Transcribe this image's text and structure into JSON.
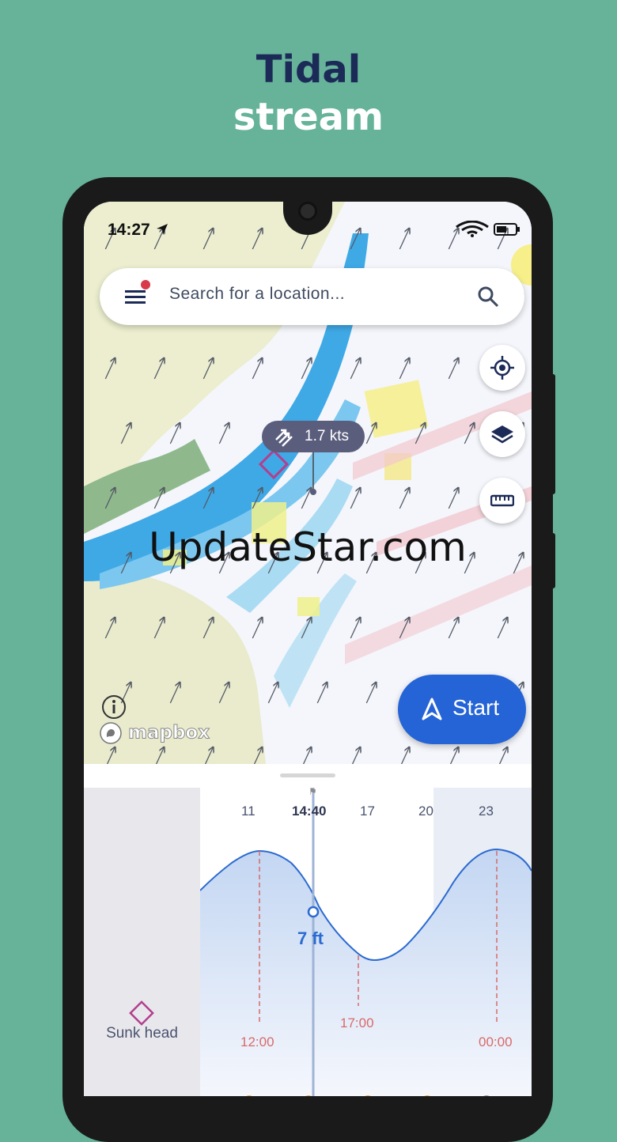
{
  "hero": {
    "line1": "Tidal",
    "line2": "stream"
  },
  "status": {
    "time": "14:27"
  },
  "search": {
    "placeholder": "Search for a location..."
  },
  "callout": {
    "speed": "1.7 kts"
  },
  "start_button": {
    "label": "Start"
  },
  "watermark": "UpdateStar.com",
  "attribution": "mapbox",
  "location": {
    "name": "Sunk head"
  },
  "tide": {
    "current_time": "14:40",
    "hour_ticks": [
      "11",
      "17",
      "20",
      "23"
    ],
    "current_height": "7 ft",
    "events": [
      "12:00",
      "17:00",
      "00:00"
    ]
  },
  "colors": {
    "accent": "#2564d6",
    "navy": "#1c2a57",
    "background": "#66b39a",
    "marker": "#b33f8e",
    "event": "#d86a6a"
  }
}
